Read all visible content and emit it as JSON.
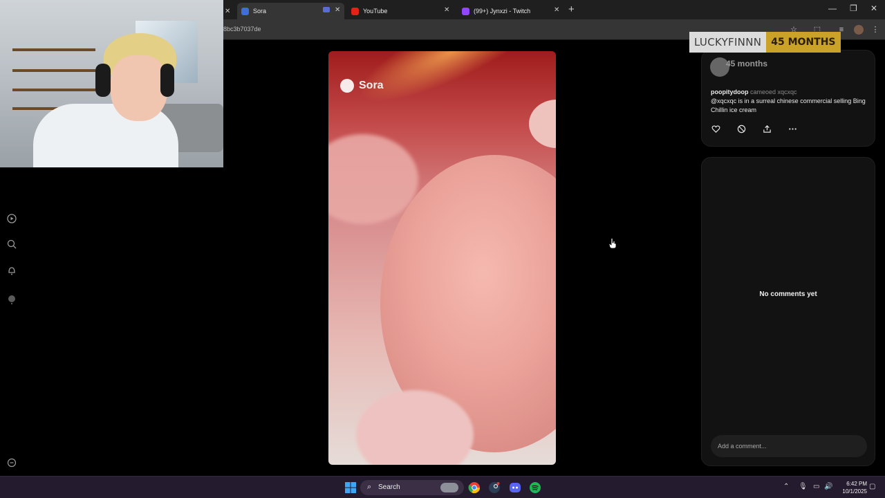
{
  "browser": {
    "tabs": [
      {
        "title": "Sora",
        "active": true
      },
      {
        "title": "YouTube",
        "active": false
      },
      {
        "title": "(99+) Jynxzi - Twitch",
        "active": false
      }
    ],
    "new_tab": "+",
    "url": "8bc3b7037de",
    "window_controls": {
      "minimize": "—",
      "maximize": "❐",
      "close": "✕"
    }
  },
  "subscription_overlay": {
    "name": "LUCKYFINNN",
    "months": "45 MONTHS"
  },
  "video": {
    "watermark": "Sora"
  },
  "post": {
    "overlay_months": "45 months",
    "author": "poopitydoop",
    "action": "cameoed xqcxqc",
    "caption": "@xqcxqc is in a surreal chinese commercial selling Bing Chillin ice cream",
    "actions": [
      "like-icon",
      "remix-icon",
      "share-icon",
      "more-icon"
    ]
  },
  "comments": {
    "empty_text": "No comments yet",
    "placeholder": "Add a comment..."
  },
  "left_rail": [
    "play-icon",
    "search-icon",
    "bell-icon",
    "profile-icon",
    "settings-icon"
  ],
  "taskbar": {
    "search_label": "Search",
    "time": "6:42 PM",
    "date": "10/1/2025",
    "apps": [
      "windows-start-icon",
      "chrome-icon",
      "steam-icon",
      "discord-icon",
      "spotify-icon"
    ],
    "colors": {
      "background": "#251b2e",
      "spotify": "#1db954",
      "discord": "#5865f2"
    }
  }
}
